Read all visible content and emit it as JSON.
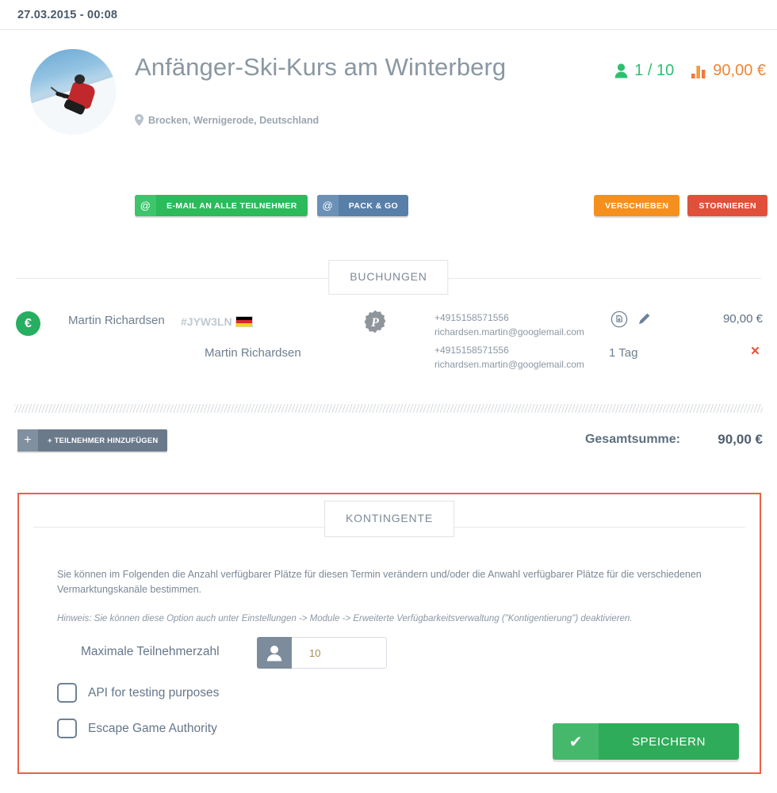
{
  "topbar": {
    "date": "27.03.2015 - 00:08"
  },
  "event": {
    "title": "Anfänger-Ski-Kurs am Winterberg",
    "location": "Brocken, Wernigerode, Deutschland",
    "avatar_alt": "skier-photo",
    "participants": "1 / 10",
    "price": "90,00 €",
    "colors": {
      "participants": "#2fbf71",
      "price": "#f08532"
    }
  },
  "actions": {
    "email_all": "E-MAIL AN ALLE TEILNEHMER",
    "email_icon": "@",
    "pack_and_go": "PACK & GO",
    "pack_icon": "@",
    "move": "VERSCHIEBEN",
    "cancel": "STORNIEREN"
  },
  "bookings_section": {
    "tab_label": "BUCHUNGEN",
    "rows": [
      {
        "status_icon": "€",
        "name": "Martin Richardsen",
        "code": "#JYW3LN",
        "flag": "germany-flag",
        "payment_icon": "paypal-icon",
        "phone": "+4915158571556",
        "email": "richardsen.martin@googlemail.com",
        "amount": "90,00 €"
      },
      {
        "subname": "Martin Richardsen",
        "phone": "+4915158571556",
        "email": "richardsen.martin@googlemail.com",
        "duration": "1 Tag",
        "remove": "×"
      }
    ]
  },
  "totals": {
    "add_participant": "+ TEILNEHMER HINZUFÜGEN",
    "add_icon": "+",
    "sum_label": "Gesamtsumme:",
    "sum_value": "90,00 €"
  },
  "kontingente": {
    "tab_label": "KONTINGENTE",
    "border_color": "#ec5f4a",
    "description": "Sie können im Folgenden die Anzahl verfügbarer Plätze für diesen Termin verändern und/oder die Anwahl verfügbarer Plätze für die verschiedenen Vermarktungskanäle bestimmen.",
    "hint": "Hinweis: Sie können diese Option auch unter Einstellungen -> Module -> Erweiterte Verfügbarkeitsverwaltung (\"Kontigentierung\") deaktivieren.",
    "max_participants_label": "Maximale Teilnehmerzahl",
    "max_participants_value": "10",
    "checkboxes": [
      {
        "label": "API for testing purposes",
        "checked": false
      },
      {
        "label": "Escape Game Authority",
        "checked": false
      }
    ],
    "save_label": "SPEICHERN",
    "save_icon": "✔"
  }
}
